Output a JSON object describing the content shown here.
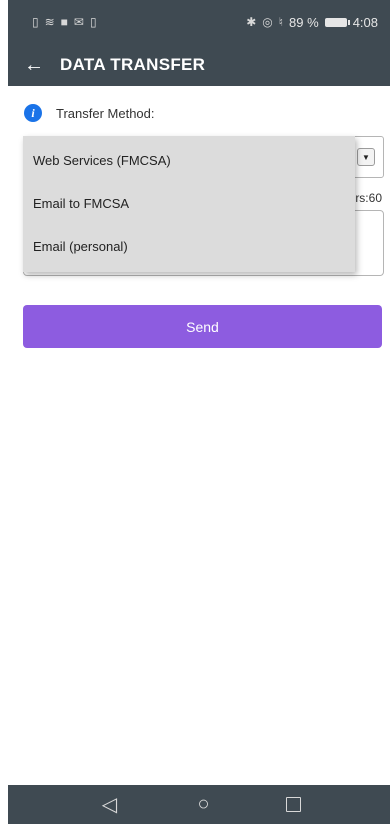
{
  "status_bar": {
    "left_icons": [
      "sim-icon",
      "wifi-icon",
      "video-icon",
      "mail-icon",
      "phone-icon"
    ],
    "right_icons": [
      "bluetooth-icon",
      "location-icon",
      "mute-icon"
    ],
    "battery_percent": "89 %",
    "time": "4:08"
  },
  "app_bar": {
    "back_icon": "←",
    "title": "DATA TRANSFER"
  },
  "form": {
    "transfer_method_label": "Transfer Method:",
    "selected_method": "Web Services (FMCSA)",
    "chars_label": "rs:60",
    "comment_value": ""
  },
  "dropdown": {
    "options": [
      "Web Services (FMCSA)",
      "Email to FMCSA",
      "Email (personal)"
    ]
  },
  "send_button": {
    "label": "Send"
  },
  "nav_bar": {
    "back": "◁",
    "home": "○"
  },
  "colors": {
    "bar_bg": "#3f4a52",
    "accent_purple": "#8d5ce0",
    "info_blue": "#1a73e8",
    "dropdown_bg": "#dcdcdc"
  }
}
